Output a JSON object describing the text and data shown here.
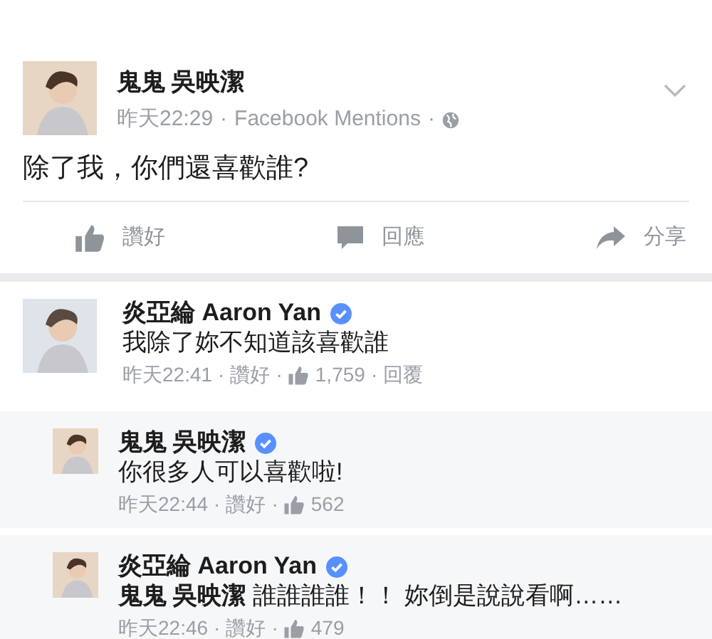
{
  "post": {
    "author": "鬼鬼 吳映潔",
    "time": "昨天22:29",
    "source": "Facebook Mentions",
    "separator": "·",
    "text": "除了我，你們還喜歡誰?",
    "actions": [
      {
        "kind": "like",
        "label": "讚好"
      },
      {
        "kind": "comment",
        "label": "回應"
      },
      {
        "kind": "share",
        "label": "分享"
      }
    ]
  },
  "comments": [
    {
      "author": "炎亞綸 Aaron Yan",
      "verified": true,
      "text": "我除了妳不知道該喜歡誰",
      "time": "昨天22:41",
      "like": "讚好",
      "likes": "1,759",
      "reply": "回覆",
      "children": [
        {
          "author": "鬼鬼 吳映潔",
          "verified": true,
          "text": "你很多人可以喜歡啦!",
          "time": "昨天22:44",
          "like": "讚好",
          "likes": "562"
        },
        {
          "author": "炎亞綸 Aaron Yan",
          "verified": true,
          "text": "**鬼鬼 吳映潔** 誰誰誰誰！！ 妳倒是說說看啊……",
          "time": "昨天22:46",
          "like": "讚好",
          "likes": "479"
        }
      ]
    }
  ]
}
